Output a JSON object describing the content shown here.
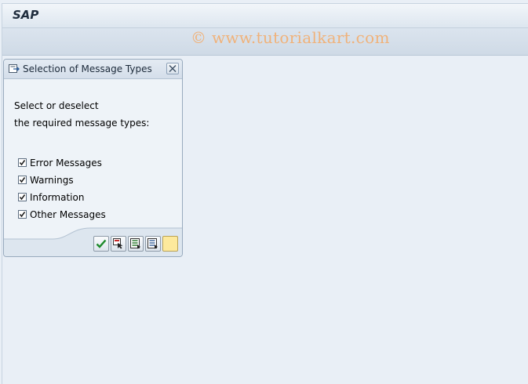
{
  "app": {
    "title": "SAP"
  },
  "watermark": "© www.tutorialkart.com",
  "dialog": {
    "title": "Selection of Message Types",
    "instruction_line1": "Select or deselect",
    "instruction_line2": "the required message types:",
    "options": [
      {
        "label": "Error Messages",
        "checked": true
      },
      {
        "label": "Warnings",
        "checked": true
      },
      {
        "label": "Information",
        "checked": true
      },
      {
        "label": "Other Messages",
        "checked": true
      }
    ],
    "buttons": [
      "continue-check-icon",
      "select-all-icon",
      "deselect-all-icon",
      "details-icon",
      "blank"
    ]
  },
  "colors": {
    "accent_orange": "#f0b27a",
    "check_green": "#1d8a2b",
    "background": "#e9eff6"
  }
}
